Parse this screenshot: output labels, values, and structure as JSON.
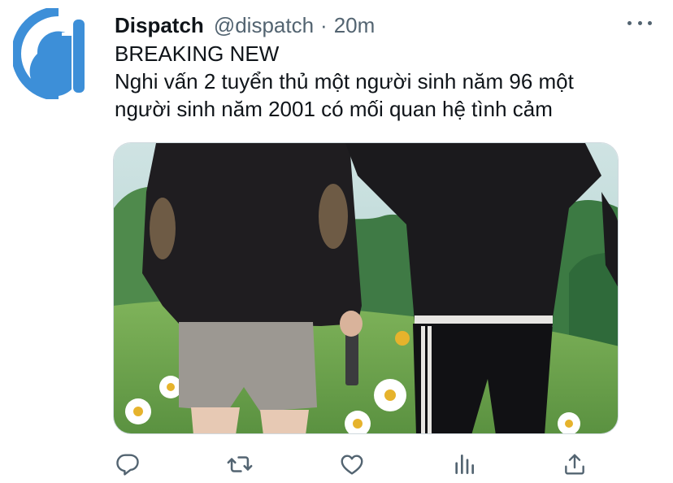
{
  "tweet": {
    "author": {
      "name": "Dispatch",
      "handle": "@dispatch",
      "separator": "·",
      "time": "20m"
    },
    "text_lines": [
      "BREAKING NEW",
      "Nghi vấn 2 tuyển thủ một người sinh năm 96 một",
      "người sinh năm 2001 có mối quan hệ tình cảm"
    ],
    "more_icon": "more-dots-icon",
    "media": {
      "description_icon": "photo",
      "palette": {
        "sky": "#bcd8d6",
        "grass": "#6fa24e",
        "trees": "#3f7a45",
        "sweater": "#1f1d20",
        "shorts": "#9c9892",
        "elbow_patch": "#6e5b45",
        "pants": "#111114"
      }
    },
    "actions": [
      {
        "name": "reply",
        "icon": "reply-icon"
      },
      {
        "name": "retweet",
        "icon": "retweet-icon"
      },
      {
        "name": "like",
        "icon": "heart-icon"
      },
      {
        "name": "analytics",
        "icon": "analytics-icon"
      },
      {
        "name": "share",
        "icon": "share-icon"
      }
    ],
    "colors": {
      "brand_blue": "#3d8fd8",
      "text_primary": "#0f1419",
      "text_secondary": "#536471",
      "icon_gray": "#536471"
    }
  }
}
